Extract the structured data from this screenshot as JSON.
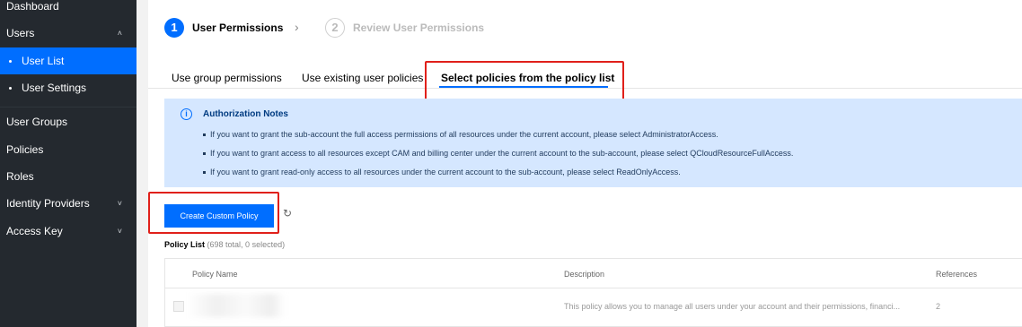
{
  "sidebar": {
    "items": [
      {
        "label": "Dashboard"
      },
      {
        "label": "Users"
      },
      {
        "label": "User List"
      },
      {
        "label": "User Settings"
      },
      {
        "label": "User Groups"
      },
      {
        "label": "Policies"
      },
      {
        "label": "Roles"
      },
      {
        "label": "Identity Providers"
      },
      {
        "label": "Access Key"
      }
    ]
  },
  "steps": [
    {
      "number": "1",
      "label": "User Permissions"
    },
    {
      "number": "2",
      "label": "Review User Permissions"
    }
  ],
  "tabs": [
    {
      "label": "Use group permissions"
    },
    {
      "label": "Use existing user policies"
    },
    {
      "label": "Select policies from the policy list"
    }
  ],
  "notice": {
    "icon": "info-icon",
    "title": "Authorization Notes",
    "lines": [
      "If you want to grant the sub-account the full access permissions of all resources under the current account, please select AdministratorAccess.",
      "If you want to grant access to all resources except CAM and billing center under the current account to the sub-account, please select QCloudResourceFullAccess.",
      "If you want to grant read-only access to all resources under the current account to the sub-account, please select ReadOnlyAccess."
    ]
  },
  "toolbar": {
    "create_label": "Create Custom Policy",
    "refresh_icon": "refresh-icon"
  },
  "policy_list": {
    "title": "Policy List",
    "meta": "(698 total, 0 selected)",
    "columns": [
      "Policy Name",
      "Description",
      "References"
    ],
    "rows": [
      {
        "description": "This policy allows you to manage all users under your account and their permissions, financi...",
        "references": "2"
      }
    ]
  },
  "colors": {
    "accent": "#006eff",
    "sidebar_bg": "#24292f",
    "notice_bg": "#d5e7ff",
    "highlight": "#e0201a"
  }
}
